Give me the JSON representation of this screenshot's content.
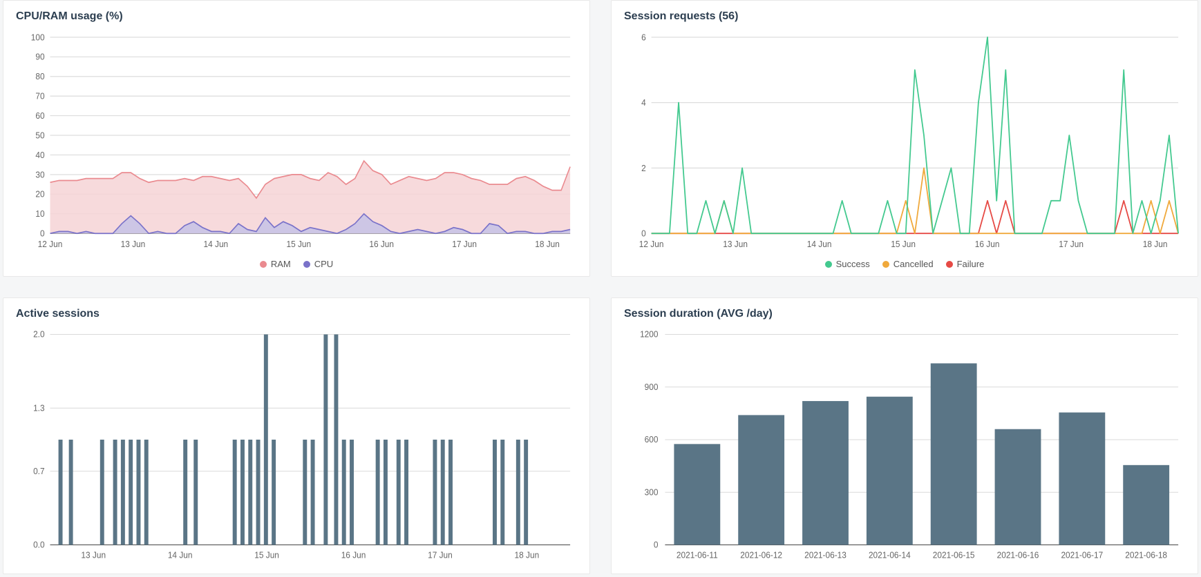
{
  "cards": {
    "cpu_ram": {
      "title": "CPU/RAM usage (%)"
    },
    "requests": {
      "title": "Session requests (56)"
    },
    "active": {
      "title": "Active sessions"
    },
    "duration": {
      "title": "Session duration (AVG /day)"
    }
  },
  "colors": {
    "ram_line": "#ea8a8f",
    "ram_fill": "#f6d4d6",
    "cpu_line": "#7a72c9",
    "cpu_fill": "#c6c2e6",
    "success": "#43c98f",
    "cancelled": "#f0a93c",
    "failure": "#e64a45",
    "bar": "#5a7586",
    "grid": "#d9d9d9"
  },
  "chart_data": [
    {
      "id": "cpu_ram",
      "type": "area",
      "title": "CPU/RAM usage (%)",
      "xlabel": "",
      "ylabel": "",
      "ylim": [
        0,
        100
      ],
      "yticks": [
        0,
        10,
        20,
        30,
        40,
        50,
        60,
        70,
        80,
        90,
        100
      ],
      "x_categories": [
        "12 Jun",
        "13 Jun",
        "14 Jun",
        "15 Jun",
        "16 Jun",
        "17 Jun",
        "18 Jun"
      ],
      "legend": [
        "RAM",
        "CPU"
      ],
      "series": [
        {
          "name": "RAM",
          "values": [
            26,
            27,
            27,
            27,
            28,
            28,
            28,
            28,
            31,
            31,
            28,
            26,
            27,
            27,
            27,
            28,
            27,
            29,
            29,
            28,
            27,
            28,
            24,
            18,
            25,
            28,
            29,
            30,
            30,
            28,
            27,
            31,
            29,
            25,
            28,
            37,
            32,
            30,
            25,
            27,
            29,
            28,
            27,
            28,
            31,
            31,
            30,
            28,
            27,
            25,
            25,
            25,
            28,
            29,
            27,
            24,
            22,
            22,
            34
          ]
        },
        {
          "name": "CPU",
          "values": [
            0,
            1,
            1,
            0,
            1,
            0,
            0,
            0,
            5,
            9,
            5,
            0,
            1,
            0,
            0,
            4,
            6,
            3,
            1,
            1,
            0,
            5,
            2,
            1,
            8,
            3,
            6,
            4,
            1,
            3,
            2,
            1,
            0,
            2,
            5,
            10,
            6,
            4,
            1,
            0,
            1,
            2,
            1,
            0,
            1,
            3,
            2,
            0,
            0,
            5,
            4,
            0,
            1,
            1,
            0,
            0,
            1,
            1,
            2
          ]
        }
      ]
    },
    {
      "id": "requests",
      "type": "line",
      "title": "Session requests (56)",
      "xlabel": "",
      "ylabel": "",
      "ylim": [
        0,
        6
      ],
      "yticks": [
        0,
        2,
        4,
        6
      ],
      "x_categories": [
        "12 Jun",
        "13 Jun",
        "14 Jun",
        "15 Jun",
        "16 Jun",
        "17 Jun",
        "18 Jun"
      ],
      "legend": [
        "Success",
        "Cancelled",
        "Failure"
      ],
      "series": [
        {
          "name": "Success",
          "values": [
            0,
            0,
            0,
            4,
            0,
            0,
            1,
            0,
            1,
            0,
            2,
            0,
            0,
            0,
            0,
            0,
            0,
            0,
            0,
            0,
            0,
            1,
            0,
            0,
            0,
            0,
            1,
            0,
            0,
            5,
            3,
            0,
            1,
            2,
            0,
            0,
            4,
            6,
            1,
            5,
            0,
            0,
            0,
            0,
            1,
            1,
            3,
            1,
            0,
            0,
            0,
            0,
            5,
            0,
            1,
            0,
            1,
            3,
            0
          ]
        },
        {
          "name": "Cancelled",
          "values": [
            0,
            0,
            0,
            0,
            0,
            0,
            0,
            0,
            1,
            0,
            0,
            0,
            0,
            0,
            0,
            0,
            0,
            0,
            0,
            0,
            0,
            0,
            0,
            0,
            0,
            0,
            0,
            0,
            1,
            0,
            2,
            0,
            0,
            0,
            0,
            0,
            0,
            0,
            0,
            0,
            0,
            0,
            0,
            0,
            0,
            0,
            0,
            0,
            0,
            0,
            0,
            0,
            0,
            0,
            0,
            1,
            0,
            1,
            0
          ]
        },
        {
          "name": "Failure",
          "values": [
            0,
            0,
            0,
            0,
            0,
            0,
            0,
            0,
            0,
            0,
            0,
            0,
            0,
            0,
            0,
            0,
            0,
            0,
            0,
            0,
            0,
            0,
            0,
            0,
            0,
            0,
            0,
            0,
            0,
            0,
            0,
            0,
            0,
            0,
            0,
            0,
            0,
            1,
            0,
            1,
            0,
            0,
            0,
            0,
            0,
            0,
            0,
            0,
            0,
            0,
            0,
            0,
            1,
            0,
            0,
            0,
            0,
            0,
            0
          ]
        }
      ]
    },
    {
      "id": "active",
      "type": "bar",
      "title": "Active sessions",
      "xlabel": "",
      "ylabel": "",
      "ylim": [
        0.0,
        2.0
      ],
      "yticks": [
        0.0,
        0.7,
        1.3,
        2.0
      ],
      "x_categories": [
        "13 Jun",
        "14 Jun",
        "15 Jun",
        "16 Jun",
        "17 Jun",
        "18 Jun"
      ],
      "values_sparse": [
        {
          "t": 0.02,
          "v": 1
        },
        {
          "t": 0.04,
          "v": 1
        },
        {
          "t": 0.1,
          "v": 1
        },
        {
          "t": 0.125,
          "v": 1
        },
        {
          "t": 0.14,
          "v": 1
        },
        {
          "t": 0.155,
          "v": 1
        },
        {
          "t": 0.17,
          "v": 1
        },
        {
          "t": 0.185,
          "v": 1
        },
        {
          "t": 0.26,
          "v": 1
        },
        {
          "t": 0.28,
          "v": 1
        },
        {
          "t": 0.355,
          "v": 1
        },
        {
          "t": 0.37,
          "v": 1
        },
        {
          "t": 0.385,
          "v": 1
        },
        {
          "t": 0.4,
          "v": 1
        },
        {
          "t": 0.415,
          "v": 2
        },
        {
          "t": 0.43,
          "v": 1
        },
        {
          "t": 0.49,
          "v": 1
        },
        {
          "t": 0.505,
          "v": 1
        },
        {
          "t": 0.53,
          "v": 2
        },
        {
          "t": 0.55,
          "v": 2
        },
        {
          "t": 0.565,
          "v": 1
        },
        {
          "t": 0.58,
          "v": 1
        },
        {
          "t": 0.63,
          "v": 1
        },
        {
          "t": 0.645,
          "v": 1
        },
        {
          "t": 0.67,
          "v": 1
        },
        {
          "t": 0.685,
          "v": 1
        },
        {
          "t": 0.74,
          "v": 1
        },
        {
          "t": 0.755,
          "v": 1
        },
        {
          "t": 0.77,
          "v": 1
        },
        {
          "t": 0.855,
          "v": 1
        },
        {
          "t": 0.87,
          "v": 1
        },
        {
          "t": 0.9,
          "v": 1
        },
        {
          "t": 0.915,
          "v": 1
        }
      ]
    },
    {
      "id": "duration",
      "type": "bar",
      "title": "Session duration (AVG /day)",
      "xlabel": "",
      "ylabel": "",
      "ylim": [
        0,
        1200
      ],
      "yticks": [
        0,
        300,
        600,
        900,
        1200
      ],
      "categories": [
        "2021-06-11",
        "2021-06-12",
        "2021-06-13",
        "2021-06-14",
        "2021-06-15",
        "2021-06-16",
        "2021-06-17",
        "2021-06-18"
      ],
      "values": [
        575,
        740,
        820,
        845,
        1035,
        660,
        755,
        455
      ]
    }
  ]
}
